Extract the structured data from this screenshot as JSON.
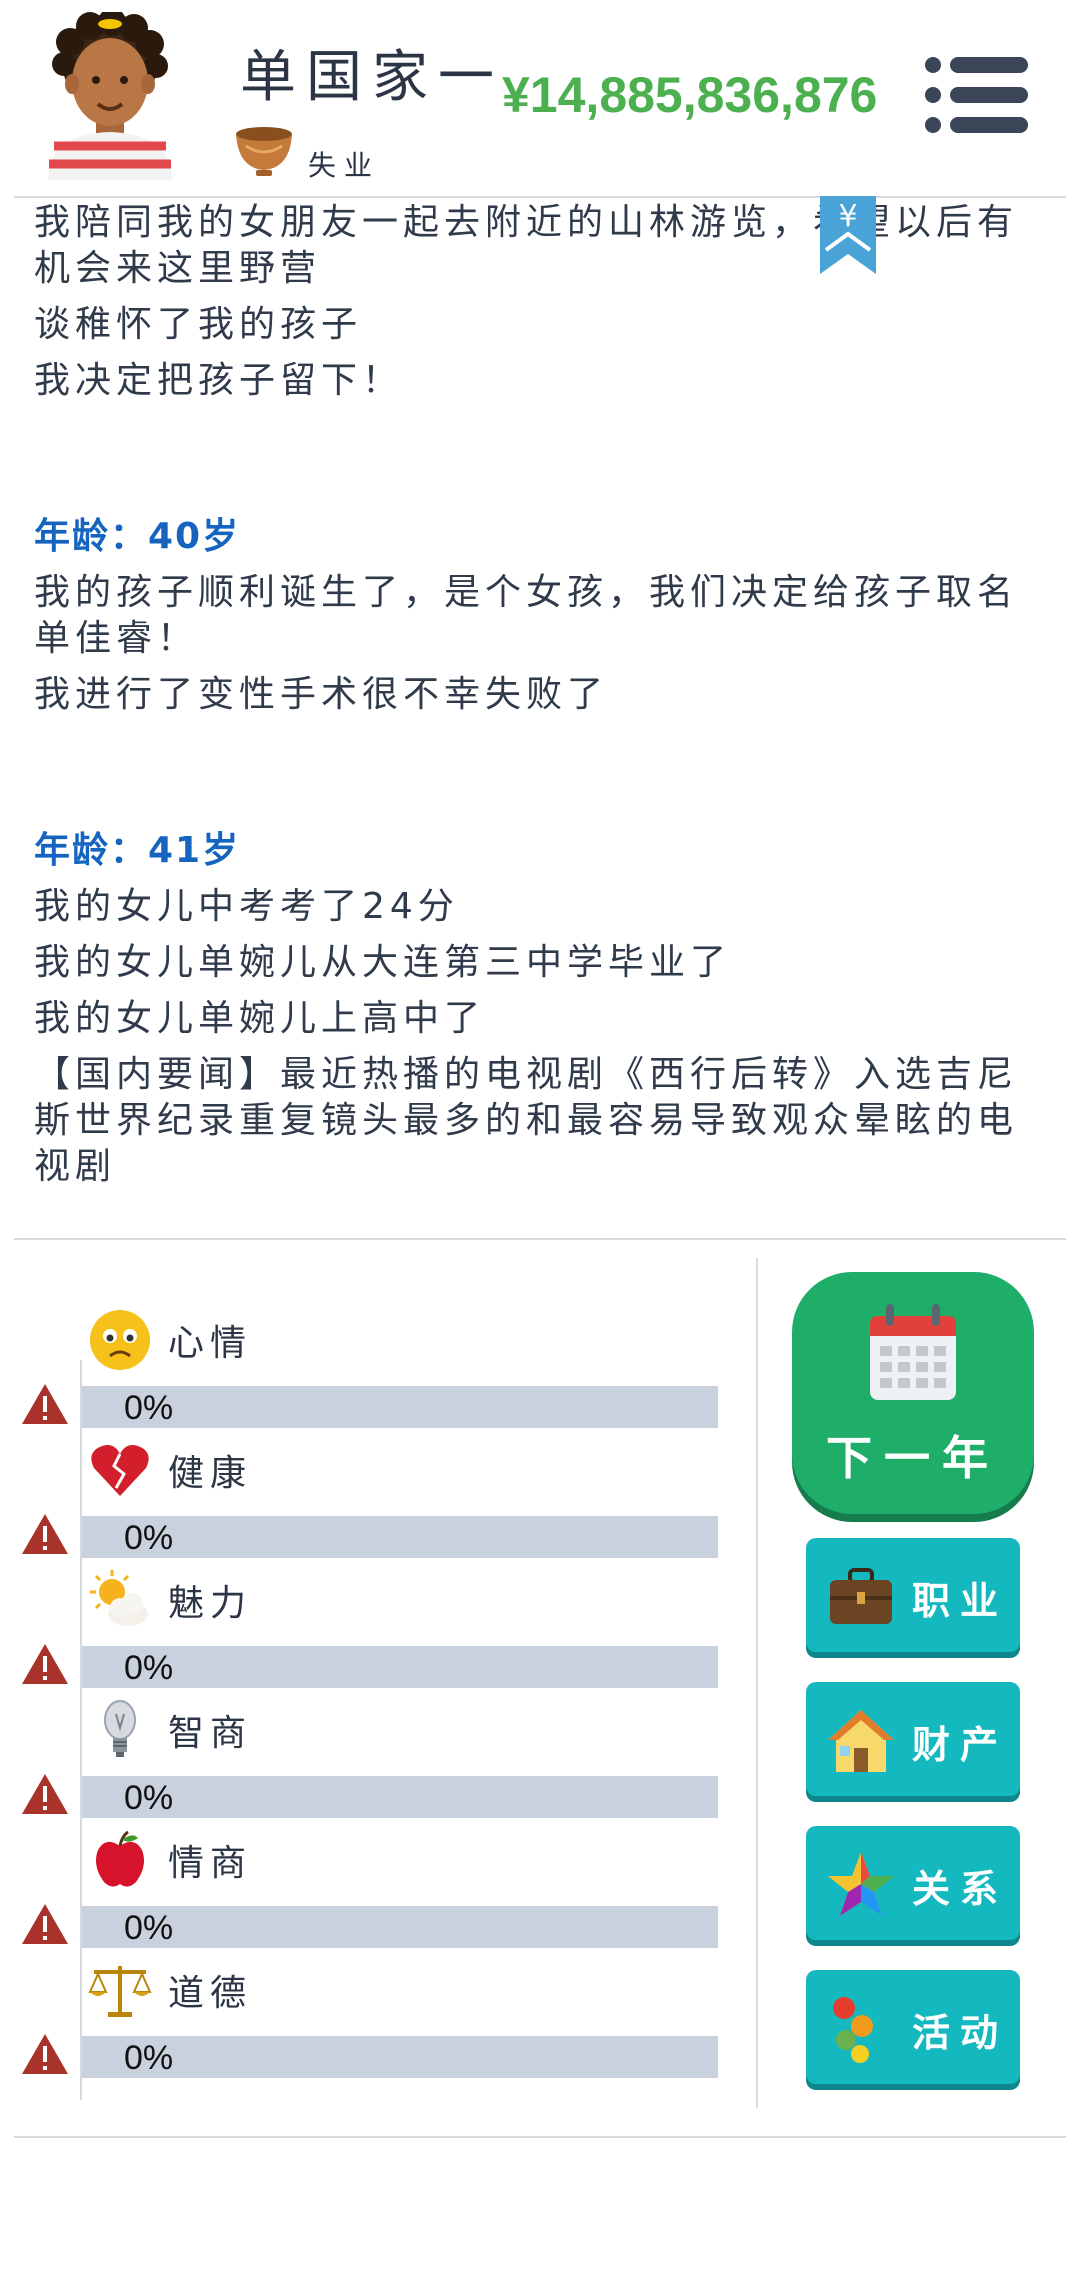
{
  "player": {
    "name": "单国家一",
    "job": "失业",
    "money": "¥14,885,836,876"
  },
  "bookmark": {
    "symbol": "¥"
  },
  "log": {
    "top_entries": [
      "我陪同我的女朋友一起去附近的山林游览，希望以后有机会来这里野营",
      "谈稚怀了我的孩子",
      "我决定把孩子留下！"
    ],
    "year40": {
      "age": "年龄：40岁",
      "entries": [
        "我的孩子顺利诞生了，是个女孩，我们决定给孩子取名单佳睿！",
        "我进行了变性手术很不幸失败了"
      ]
    },
    "year41": {
      "age": "年龄：41岁",
      "entries": [
        "我的女儿中考考了24分",
        "我的女儿单婉儿从大连第三中学毕业了",
        "我的女儿单婉儿上高中了",
        "【国内要闻】最近热播的电视剧《西行后转》入选吉尼斯世界纪录重复镜头最多的和最容易导致观众晕眩的电视剧"
      ]
    }
  },
  "stats": [
    {
      "label": "心情",
      "value": "0%",
      "fraction": 0,
      "icon": "sad-face-icon"
    },
    {
      "label": "健康",
      "value": "0%",
      "fraction": 0,
      "icon": "broken-heart-icon"
    },
    {
      "label": "魅力",
      "value": "0%",
      "fraction": 0,
      "icon": "sun-cloud-icon"
    },
    {
      "label": "智商",
      "value": "0%",
      "fraction": 0,
      "icon": "lightbulb-icon"
    },
    {
      "label": "情商",
      "value": "0%",
      "fraction": 0,
      "icon": "apple-icon"
    },
    {
      "label": "道德",
      "value": "0%",
      "fraction": 0,
      "icon": "scales-icon"
    }
  ],
  "buttons": {
    "next_year": "下一年",
    "career": "职业",
    "property": "财产",
    "relations": "关系",
    "activities": "活动"
  },
  "colors": {
    "money": "#4caf50",
    "age_heading": "#1565c0",
    "next_button": "#1fad6a",
    "side_button": "#14b9bf",
    "bar_track": "#c8d1dd"
  }
}
